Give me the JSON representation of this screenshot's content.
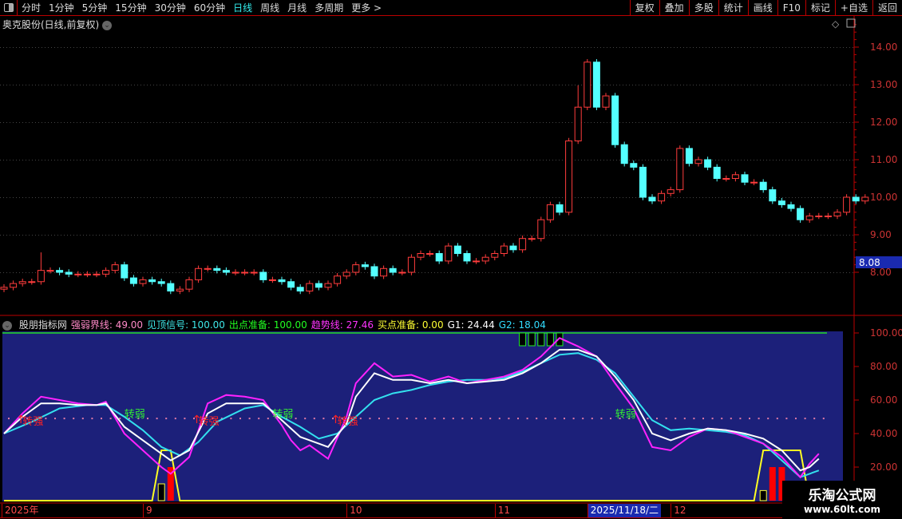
{
  "toolbar": {
    "periods": [
      "分时",
      "1分钟",
      "5分钟",
      "15分钟",
      "30分钟",
      "60分钟",
      "日线",
      "周线",
      "月线",
      "多周期",
      "更多 >"
    ],
    "active": "日线",
    "right_buttons": [
      "复权",
      "叠加",
      "多股",
      "统计",
      "画线",
      "F10",
      "标记",
      "+自选",
      "返回"
    ]
  },
  "chart_title": "奥克股份(日线,前复权)",
  "price_axis": [
    "14.00",
    "13.00",
    "12.00",
    "11.00",
    "10.00",
    "9.00",
    "8.00"
  ],
  "last_price_label": "8.08",
  "indicator": {
    "name": "股朋指标网",
    "values": [
      {
        "label": "强弱界线: 49.00",
        "color": "#ff8ac8"
      },
      {
        "label": "见顶信号: 100.00",
        "color": "#3ee8e8"
      },
      {
        "label": "出点准备: 100.00",
        "color": "#22ff22"
      },
      {
        "label": "趋势线: 27.46",
        "color": "#ff33ff"
      },
      {
        "label": "买点准备: 0.00",
        "color": "#ffff33"
      },
      {
        "label": "G1: 24.44",
        "color": "#ffffff"
      },
      {
        "label": "G2: 18.04",
        "color": "#33ddff"
      }
    ],
    "axis": [
      "100.00",
      "80.00",
      "60.00",
      "40.00",
      "20.00"
    ],
    "signals": [
      {
        "i": 2,
        "text": "转强",
        "type": "up"
      },
      {
        "i": 13,
        "text": "转弱",
        "type": "down"
      },
      {
        "i": 21,
        "text": "转强",
        "type": "up"
      },
      {
        "i": 29,
        "text": "转弱",
        "type": "down"
      },
      {
        "i": 36,
        "text": "转强",
        "type": "up"
      },
      {
        "i": 66,
        "text": "转弱",
        "type": "down"
      }
    ]
  },
  "date_axis": [
    {
      "i": 0,
      "text": "2025年"
    },
    {
      "i": 15,
      "text": "9"
    },
    {
      "i": 37,
      "text": "10"
    },
    {
      "i": 53,
      "text": "11"
    },
    {
      "i": 63,
      "text": "2025/11/18/二",
      "highlight": true
    },
    {
      "i": 72,
      "text": "12"
    }
  ],
  "watermark": {
    "line1": "乐淘公式网",
    "line2": "www.60lt.com"
  },
  "chart_data": {
    "type": "candlestick",
    "ylim": [
      7.2,
      14.8
    ],
    "closes": [
      7.6,
      7.7,
      7.75,
      7.75,
      8.05,
      8.05,
      8.0,
      7.95,
      7.95,
      7.95,
      7.95,
      8.05,
      8.2,
      7.85,
      7.7,
      7.8,
      7.75,
      7.7,
      7.5,
      7.55,
      7.8,
      8.1,
      8.1,
      8.05,
      8.0,
      8.0,
      8.0,
      8.0,
      7.8,
      7.8,
      7.75,
      7.6,
      7.5,
      7.7,
      7.6,
      7.7,
      7.9,
      8.0,
      8.2,
      8.15,
      7.9,
      8.1,
      8.0,
      8.0,
      8.4,
      8.5,
      8.5,
      8.3,
      8.7,
      8.5,
      8.3,
      8.3,
      8.4,
      8.5,
      8.7,
      8.6,
      8.9,
      8.9,
      9.4,
      9.8,
      9.6,
      11.5,
      12.4,
      13.6,
      12.4,
      12.7,
      11.4,
      10.9,
      10.8,
      10.0,
      9.9,
      10.1,
      10.2,
      11.3,
      10.9,
      11.0,
      10.8,
      10.5,
      10.5,
      10.6,
      10.4,
      10.4,
      10.2,
      9.9,
      9.8,
      9.7,
      9.4,
      9.5,
      9.5,
      9.5,
      9.6,
      10.0,
      9.9,
      10.0
    ],
    "trend_magenta": [
      [
        0,
        40
      ],
      [
        2,
        52
      ],
      [
        4,
        62
      ],
      [
        6,
        60
      ],
      [
        8,
        58
      ],
      [
        10,
        57
      ],
      [
        11,
        59
      ],
      [
        13,
        40
      ],
      [
        15,
        30
      ],
      [
        17,
        20
      ],
      [
        18,
        16
      ],
      [
        20,
        26
      ],
      [
        22,
        58
      ],
      [
        24,
        63
      ],
      [
        26,
        62
      ],
      [
        28,
        60
      ],
      [
        30,
        45
      ],
      [
        31,
        36
      ],
      [
        32,
        30
      ],
      [
        33,
        33
      ],
      [
        35,
        25
      ],
      [
        37,
        50
      ],
      [
        38,
        70
      ],
      [
        40,
        82
      ],
      [
        42,
        74
      ],
      [
        44,
        75
      ],
      [
        46,
        71
      ],
      [
        48,
        74
      ],
      [
        50,
        70
      ],
      [
        52,
        72
      ],
      [
        54,
        74
      ],
      [
        56,
        78
      ],
      [
        58,
        86
      ],
      [
        60,
        97
      ],
      [
        62,
        92
      ],
      [
        64,
        86
      ],
      [
        66,
        70
      ],
      [
        68,
        55
      ],
      [
        70,
        32
      ],
      [
        72,
        30
      ],
      [
        74,
        38
      ],
      [
        76,
        43
      ],
      [
        78,
        42
      ],
      [
        80,
        38
      ],
      [
        82,
        34
      ],
      [
        84,
        26
      ],
      [
        86,
        14
      ],
      [
        87,
        22
      ],
      [
        88,
        28
      ]
    ],
    "g1_white": [
      [
        0,
        40
      ],
      [
        2,
        50
      ],
      [
        4,
        58
      ],
      [
        6,
        58
      ],
      [
        8,
        57
      ],
      [
        10,
        57
      ],
      [
        11,
        58
      ],
      [
        13,
        44
      ],
      [
        15,
        36
      ],
      [
        17,
        28
      ],
      [
        18,
        24
      ],
      [
        20,
        30
      ],
      [
        22,
        52
      ],
      [
        24,
        58
      ],
      [
        26,
        58
      ],
      [
        28,
        58
      ],
      [
        30,
        48
      ],
      [
        32,
        38
      ],
      [
        34,
        34
      ],
      [
        35,
        32
      ],
      [
        37,
        46
      ],
      [
        38,
        62
      ],
      [
        40,
        76
      ],
      [
        42,
        72
      ],
      [
        44,
        72
      ],
      [
        46,
        70
      ],
      [
        48,
        72
      ],
      [
        50,
        70
      ],
      [
        52,
        71
      ],
      [
        54,
        72
      ],
      [
        56,
        76
      ],
      [
        58,
        82
      ],
      [
        60,
        90
      ],
      [
        62,
        90
      ],
      [
        64,
        86
      ],
      [
        66,
        74
      ],
      [
        68,
        60
      ],
      [
        70,
        40
      ],
      [
        72,
        36
      ],
      [
        74,
        40
      ],
      [
        76,
        43
      ],
      [
        78,
        42
      ],
      [
        80,
        40
      ],
      [
        82,
        37
      ],
      [
        84,
        30
      ],
      [
        86,
        18
      ],
      [
        87,
        20
      ],
      [
        88,
        25
      ]
    ],
    "g2_cyan": [
      [
        0,
        40
      ],
      [
        3,
        47
      ],
      [
        6,
        55
      ],
      [
        9,
        57
      ],
      [
        11,
        57
      ],
      [
        13,
        50
      ],
      [
        15,
        42
      ],
      [
        17,
        32
      ],
      [
        19,
        27
      ],
      [
        21,
        35
      ],
      [
        23,
        47
      ],
      [
        26,
        55
      ],
      [
        28,
        57
      ],
      [
        30,
        50
      ],
      [
        32,
        44
      ],
      [
        34,
        37
      ],
      [
        36,
        40
      ],
      [
        38,
        50
      ],
      [
        40,
        60
      ],
      [
        42,
        64
      ],
      [
        44,
        66
      ],
      [
        46,
        69
      ],
      [
        48,
        71
      ],
      [
        50,
        72
      ],
      [
        52,
        72
      ],
      [
        54,
        73
      ],
      [
        56,
        77
      ],
      [
        58,
        82
      ],
      [
        60,
        87
      ],
      [
        62,
        88
      ],
      [
        64,
        84
      ],
      [
        66,
        76
      ],
      [
        68,
        62
      ],
      [
        70,
        48
      ],
      [
        72,
        42
      ],
      [
        74,
        43
      ],
      [
        76,
        42
      ],
      [
        78,
        41
      ],
      [
        80,
        39
      ],
      [
        82,
        34
      ],
      [
        84,
        24
      ],
      [
        86,
        14
      ],
      [
        88,
        18
      ]
    ],
    "buy_prep_yellow": [
      [
        0,
        0
      ],
      [
        16,
        0
      ],
      [
        17,
        30
      ],
      [
        18,
        30
      ],
      [
        19,
        0
      ],
      [
        81,
        0
      ],
      [
        82,
        30
      ],
      [
        86,
        30
      ],
      [
        87,
        0
      ],
      [
        88,
        0
      ]
    ],
    "red_bars": [
      {
        "i": 18,
        "v": 20
      },
      {
        "i": 83,
        "v": 20
      },
      {
        "i": 84,
        "v": 20
      }
    ],
    "black_bars": [
      {
        "i": 17,
        "v": 10
      },
      {
        "i": 82,
        "v": 6
      }
    ],
    "top_bars": [
      56,
      57,
      58,
      59,
      60
    ],
    "strong_weak_line": 49,
    "top_line": 100
  }
}
